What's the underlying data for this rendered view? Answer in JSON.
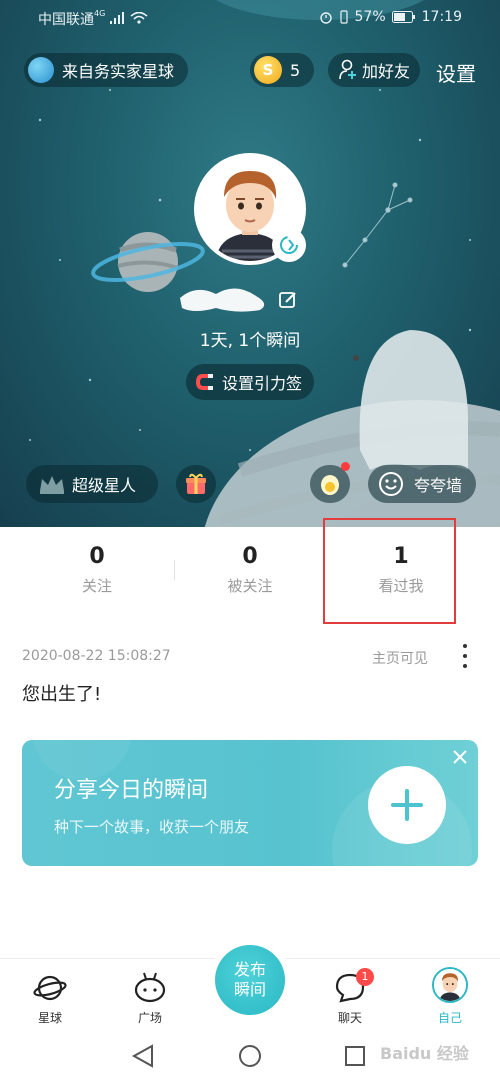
{
  "status_bar": {
    "carrier": "中国联通",
    "network": "4G",
    "battery": "57%",
    "time": "17:19"
  },
  "header": {
    "planet_label": "来自务实家星球",
    "coins": "5",
    "add_friend_label": "加好友",
    "settings_label": "设置"
  },
  "profile": {
    "stats_text": "1天, 1个瞬间",
    "tag_button_label": "设置引力签"
  },
  "actions": {
    "super_label": "超级星人",
    "praise_label": "夸夸墙"
  },
  "counts": [
    {
      "value": "0",
      "label": "关注"
    },
    {
      "value": "0",
      "label": "被关注"
    },
    {
      "value": "1",
      "label": "看过我"
    }
  ],
  "post": {
    "timestamp": "2020-08-22 15:08:27",
    "visibility": "主页可见",
    "text": "您出生了!"
  },
  "share_card": {
    "title": "分享今日的瞬间",
    "subtitle": "种下一个故事，收获一个朋友"
  },
  "tabbar": {
    "tabs": [
      {
        "label": "星球",
        "icon": "planet-icon"
      },
      {
        "label": "广场",
        "icon": "square-icon"
      },
      {
        "label": "聊天",
        "icon": "chat-icon",
        "badge": "1"
      },
      {
        "label": "自己",
        "icon": "me-avatar",
        "active": true
      }
    ],
    "publish_line1": "发布",
    "publish_line2": "瞬间"
  },
  "watermark": "Baidu 经验",
  "colors": {
    "accent": "#2bb8c4",
    "badge": "#ff4a4a",
    "highlight": "#e33c3c"
  }
}
